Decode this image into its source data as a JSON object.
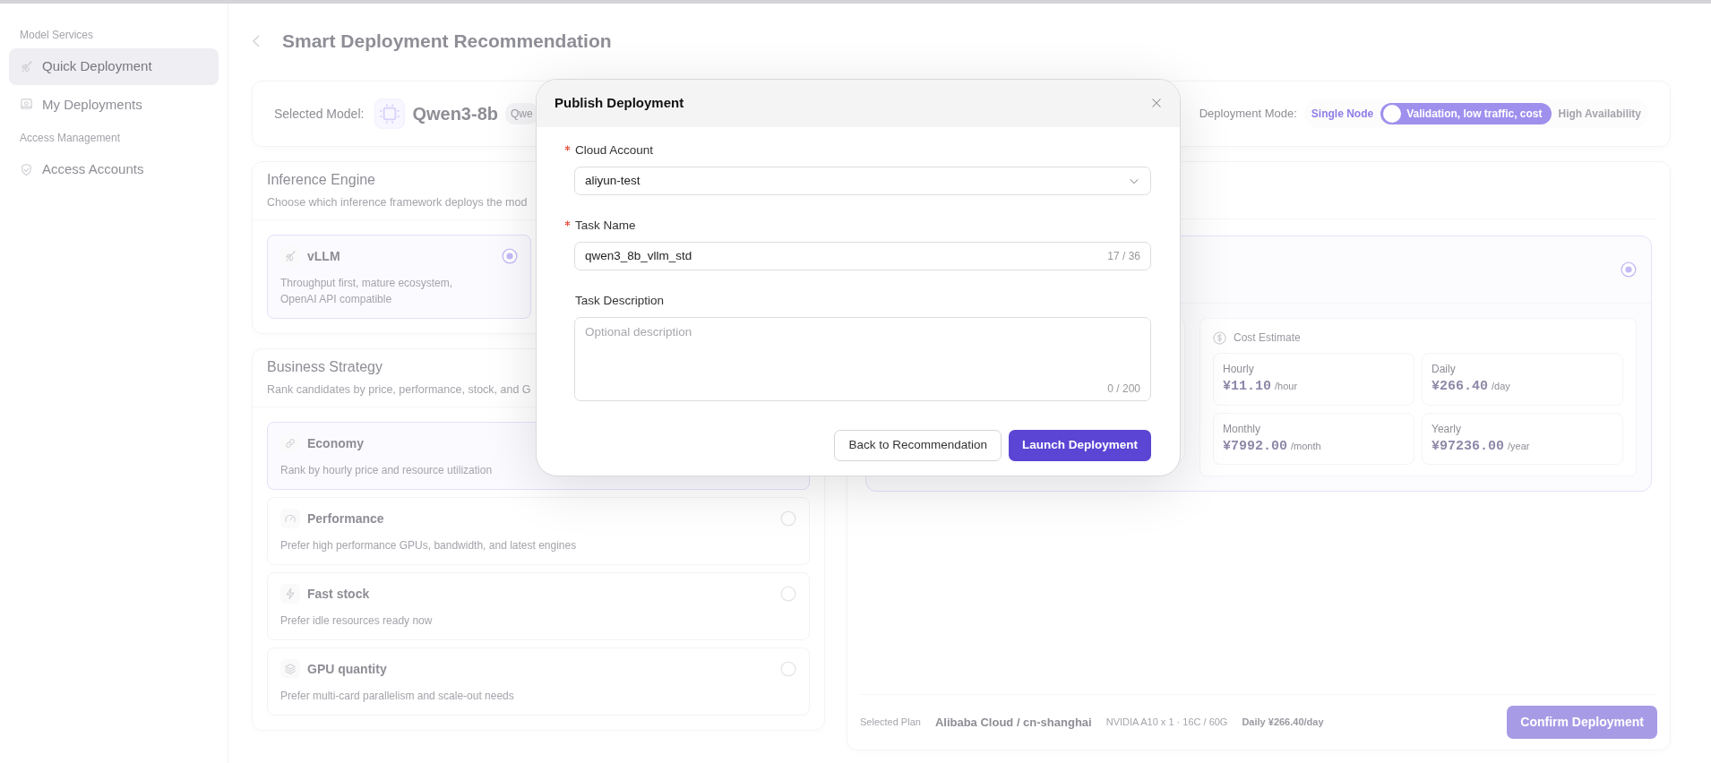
{
  "sidebar": {
    "groups": [
      {
        "title": "Model Services",
        "items": [
          {
            "label": "Quick Deployment",
            "selected": true
          },
          {
            "label": "My Deployments",
            "selected": false
          }
        ]
      },
      {
        "title": "Access Management",
        "items": [
          {
            "label": "Access Accounts",
            "selected": false
          }
        ]
      }
    ]
  },
  "page_title": "Smart Deployment Recommendation",
  "model_bar": {
    "label": "Selected Model:",
    "model": "Qwen3-8b",
    "tag": "Qwe",
    "mode_label": "Deployment Mode:",
    "mode_options": [
      {
        "label": "Single Node",
        "selected": true
      },
      {
        "label": "High Availability",
        "selected": false
      }
    ],
    "switch_text": "Validation, low traffic, cost",
    "switch_on": false
  },
  "inference_engine": {
    "title": "Inference Engine",
    "subtitle": "Choose which inference framework deploys the mod",
    "options": [
      {
        "name": "vLLM",
        "description": "Throughput first, mature ecosystem, OpenAI API compatible",
        "selected": true
      }
    ]
  },
  "business_strategy": {
    "title": "Business Strategy",
    "subtitle": "Rank candidates by price, performance, stock, and G",
    "options": [
      {
        "name": "Economy",
        "description": "Rank by hourly price and resource utilization",
        "selected": true
      },
      {
        "name": "Performance",
        "description": "Prefer high performance GPUs, bandwidth, and latest engines",
        "selected": false
      },
      {
        "name": "Fast stock",
        "description": "Prefer idle resources ready now",
        "selected": false
      },
      {
        "name": "GPU quantity",
        "description": "Prefer multi-card parallelism and scale-out needs",
        "selected": false
      }
    ]
  },
  "recommendation": {
    "selected": true,
    "cost_title": "Cost Estimate",
    "costs": [
      {
        "label": "Hourly",
        "value": "¥11.10",
        "unit": "/hour"
      },
      {
        "label": "Daily",
        "value": "¥266.40",
        "unit": "/day"
      },
      {
        "label": "Monthly",
        "value": "¥7992.00",
        "unit": "/month"
      },
      {
        "label": "Yearly",
        "value": "¥97236.00",
        "unit": "/year"
      }
    ]
  },
  "footer": {
    "label": "Selected Plan",
    "plan": "Alibaba Cloud / cn-shanghai",
    "spec": "NVIDIA A10 x 1 · 16C / 60G",
    "daily": "Daily ¥266.40/day",
    "button": "Confirm Deployment"
  },
  "dialog": {
    "title": "Publish Deployment",
    "fields": [
      {
        "kind": "select",
        "label": "Cloud Account",
        "required": true,
        "value": "aliyun-test"
      },
      {
        "kind": "input",
        "label": "Task Name",
        "required": true,
        "value": "qwen3_8b_vllm_std",
        "count": "17 / 36"
      },
      {
        "kind": "textarea",
        "label": "Task Description",
        "required": false,
        "placeholder": "Optional description",
        "count": "0 / 200"
      }
    ],
    "buttons": [
      {
        "label": "Back to Recommendation",
        "kind": "secondary"
      },
      {
        "label": "Launch Deployment",
        "kind": "primary"
      }
    ]
  }
}
